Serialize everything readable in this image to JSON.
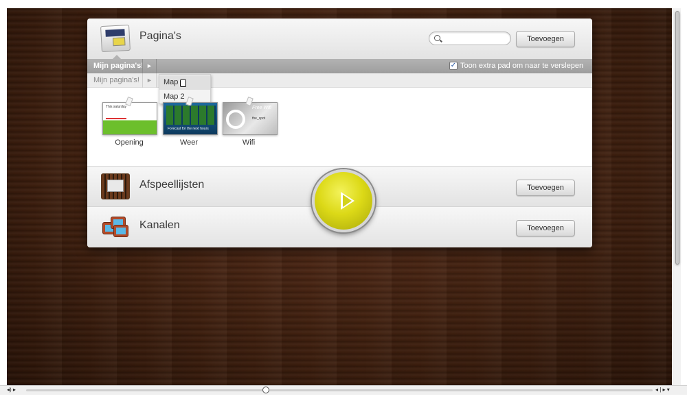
{
  "pages_section": {
    "title": "Pagina's",
    "add_label": "Toevoegen",
    "search": {
      "value": "",
      "placeholder": ""
    }
  },
  "breadcrumb": {
    "current": "Mijn pagina's!",
    "arrow": "►",
    "option_label": "Toon extra pad om naar te verslepen",
    "option_checked": true,
    "check_glyph": "✓"
  },
  "breadcrumb_extra": {
    "label": "Mijn pagina's!",
    "arrow": "►"
  },
  "dropdown": {
    "items": [
      {
        "label": "Map 1"
      },
      {
        "label": "Map 2"
      }
    ]
  },
  "pages": [
    {
      "name": "Opening",
      "thumb_text": "This saturday"
    },
    {
      "name": "Weer",
      "thumb_text": "Forecast for the next hours"
    },
    {
      "name": "Wifi",
      "thumb_text": "Free Wifi",
      "thumb_sub": "the_spot"
    }
  ],
  "playlists_section": {
    "title": "Afspeellijsten",
    "add_label": "Toevoegen"
  },
  "channels_section": {
    "title": "Kanalen",
    "add_label": "Toevoegen"
  },
  "player_controls": {
    "left": "◂) ▸",
    "right": "◂ | ▸ ▾"
  },
  "icons": {
    "search": "search-icon",
    "play": "play-icon",
    "checkbox": "checkbox-icon"
  }
}
